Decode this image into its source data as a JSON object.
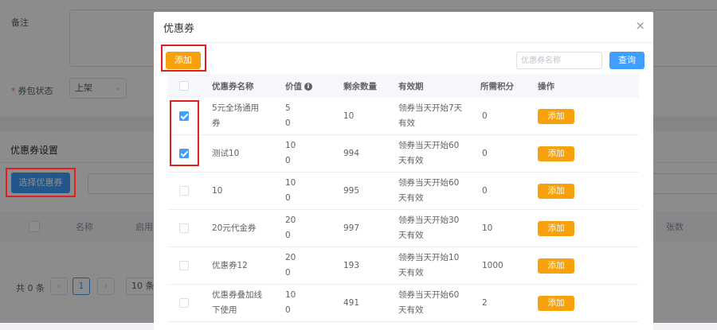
{
  "background": {
    "remark_label": "备注",
    "status_label": "券包状态",
    "status_required": "*",
    "status_value": "上架",
    "coupon_section_title": "优惠券设置",
    "select_coupon_button": "选择优惠券",
    "table_headers": {
      "name": "名称",
      "enabled": "启用",
      "count": "张数"
    },
    "pagination": {
      "total": "共 0 条",
      "prev": "‹",
      "current_page": "1",
      "next": "›",
      "page_size": "10 条/"
    }
  },
  "dialog": {
    "title": "优惠券",
    "close_icon": "×",
    "add_button": "添加",
    "search_placeholder": "优惠券名称",
    "search_button": "查询",
    "columns": {
      "name": "优惠券名称",
      "value": "价值",
      "remaining": "剩余数量",
      "validity": "有效期",
      "points": "所需积分",
      "action": "操作"
    },
    "info_icon": "i",
    "rows": [
      {
        "checked": true,
        "name_l1": "5元全场通用",
        "name_l2": "券",
        "value_l1": "5",
        "value_l2": "0",
        "remaining": "10",
        "validity_l1": "领券当天开始7天",
        "validity_l2": "有效",
        "points": "0",
        "action": "添加"
      },
      {
        "checked": true,
        "name_l1": "测试10",
        "name_l2": "",
        "value_l1": "10",
        "value_l2": "0",
        "remaining": "994",
        "validity_l1": "领券当天开始60",
        "validity_l2": "天有效",
        "points": "0",
        "action": "添加"
      },
      {
        "checked": false,
        "name_l1": "10",
        "name_l2": "",
        "value_l1": "10",
        "value_l2": "0",
        "remaining": "995",
        "validity_l1": "领券当天开始60",
        "validity_l2": "天有效",
        "points": "0",
        "action": "添加"
      },
      {
        "checked": false,
        "name_l1": "20元代金券",
        "name_l2": "",
        "value_l1": "20",
        "value_l2": "0",
        "remaining": "997",
        "validity_l1": "领券当天开始30",
        "validity_l2": "天有效",
        "points": "10",
        "action": "添加"
      },
      {
        "checked": false,
        "name_l1": "优惠券12",
        "name_l2": "",
        "value_l1": "20",
        "value_l2": "0",
        "remaining": "193",
        "validity_l1": "领券当天开始10",
        "validity_l2": "天有效",
        "points": "1000",
        "action": "添加"
      },
      {
        "checked": false,
        "name_l1": "优惠券叠加线",
        "name_l2": "下使用",
        "value_l1": "10",
        "value_l2": "0",
        "remaining": "491",
        "validity_l1": "领券当天开始60",
        "validity_l2": "天有效",
        "points": "2",
        "action": "添加"
      }
    ]
  }
}
